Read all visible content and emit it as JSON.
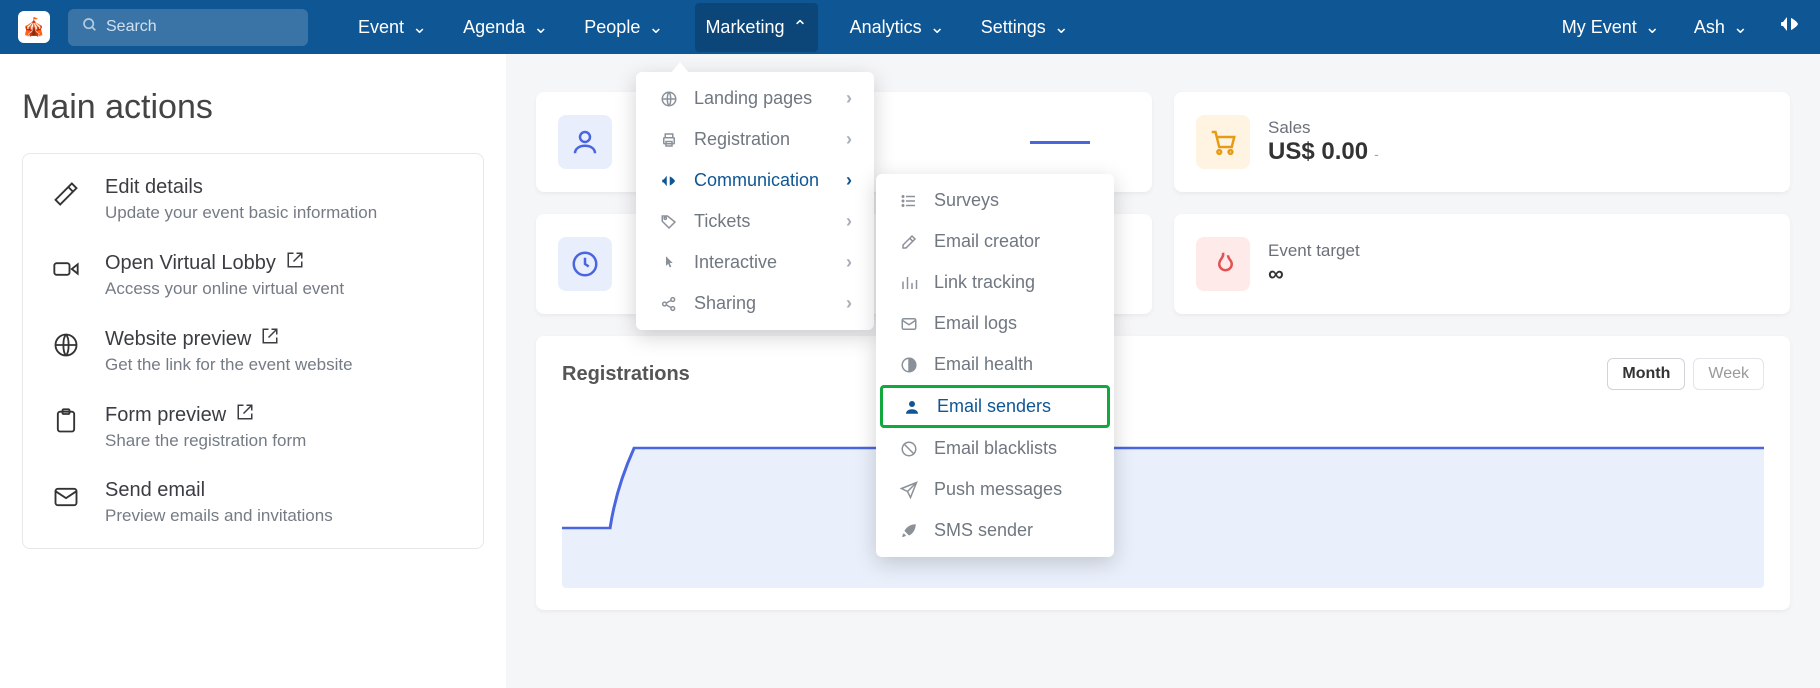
{
  "search": {
    "placeholder": "Search"
  },
  "nav": {
    "items": [
      "Event",
      "Agenda",
      "People",
      "Marketing",
      "Analytics",
      "Settings"
    ],
    "active": "Marketing",
    "right": {
      "event": "My Event",
      "user": "Ash"
    }
  },
  "main_actions": {
    "title": "Main actions",
    "items": [
      {
        "title": "Edit details",
        "desc": "Update your event basic information",
        "ext": false
      },
      {
        "title": "Open Virtual Lobby",
        "desc": "Access your online virtual event",
        "ext": true
      },
      {
        "title": "Website preview",
        "desc": "Get the link for the event website",
        "ext": true
      },
      {
        "title": "Form preview",
        "desc": "Share the registration form",
        "ext": true
      },
      {
        "title": "Send email",
        "desc": "Preview emails and invitations",
        "ext": false
      }
    ]
  },
  "marketing_menu": {
    "items": [
      {
        "label": "Landing pages"
      },
      {
        "label": "Registration"
      },
      {
        "label": "Communication",
        "active": true
      },
      {
        "label": "Tickets"
      },
      {
        "label": "Interactive"
      },
      {
        "label": "Sharing"
      }
    ]
  },
  "communication_menu": {
    "items": [
      {
        "label": "Surveys"
      },
      {
        "label": "Email creator"
      },
      {
        "label": "Link tracking"
      },
      {
        "label": "Email logs"
      },
      {
        "label": "Email health"
      },
      {
        "label": "Email senders",
        "highlighted": true
      },
      {
        "label": "Email blacklists"
      },
      {
        "label": "Push messages"
      },
      {
        "label": "SMS sender"
      }
    ]
  },
  "stats": {
    "sales": {
      "label": "Sales",
      "value": "US$ 0.00",
      "sub": "-"
    },
    "target": {
      "label": "Event target",
      "value": "∞"
    }
  },
  "chart": {
    "title": "Registrations",
    "toggle": {
      "month": "Month",
      "week": "Week",
      "active": "Month"
    }
  }
}
